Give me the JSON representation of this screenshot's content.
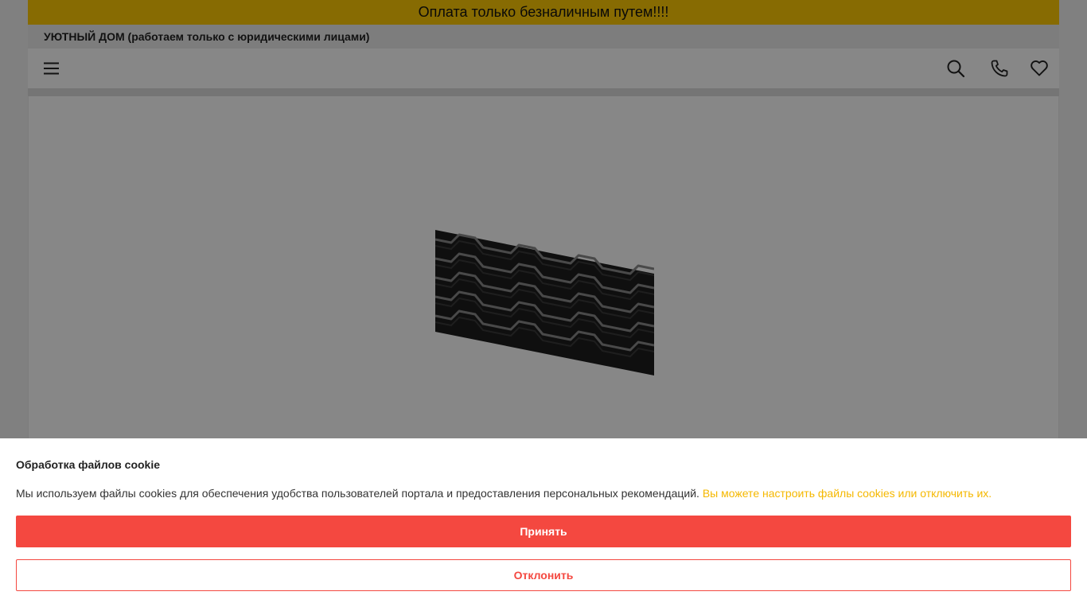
{
  "promo": {
    "text": "Оплата только безналичным путем!!!!"
  },
  "company": {
    "name": "УЮТНЫЙ ДОМ (работаем только с юридическими лицами)"
  },
  "nav": {
    "icons": [
      "menu-icon",
      "search-icon",
      "phone-icon",
      "heart-icon"
    ]
  },
  "colors": {
    "promo_bg": "#ffca05",
    "accent_red": "#f44840",
    "link_yellow": "#f5b800"
  },
  "cookie": {
    "title": "Обработка файлов cookie",
    "text": "Мы используем файлы cookies для обеспечения удобства пользователей портала и предоставления персональных рекомендаций.",
    "link": "Вы можете настроить файлы cookies или отключить их.",
    "accept_label": "Принять",
    "decline_label": "Отклонить"
  }
}
